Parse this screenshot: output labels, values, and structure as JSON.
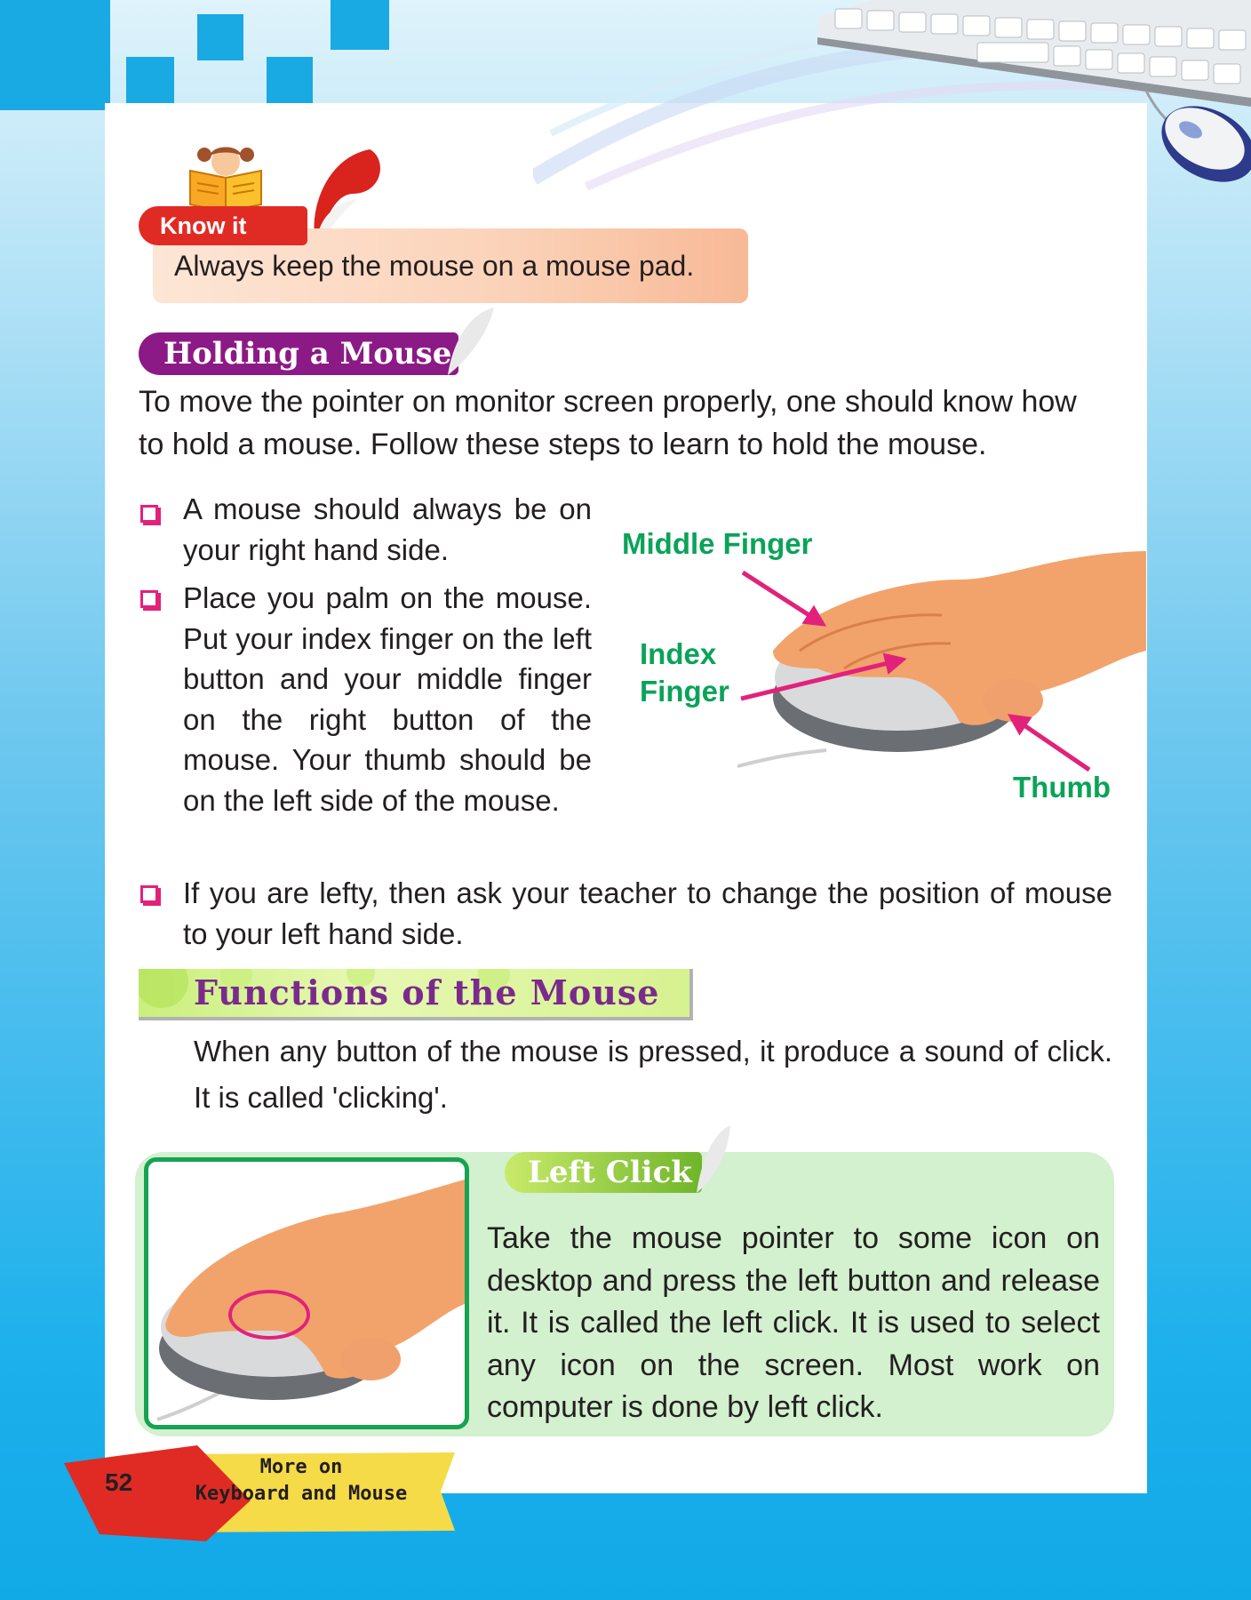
{
  "know_it": {
    "tag": "Know it",
    "tip": "Always keep the mouse on a mouse pad."
  },
  "holding": {
    "heading": "Holding a Mouse",
    "intro_line1": "To move the pointer on monitor screen properly, one should know how",
    "intro_line2": "to hold a mouse. Follow these steps to learn to hold the mouse.",
    "bullets": [
      "A mouse should always be on your right hand side.",
      "Place you palm on the mouse. Put your index finger on the left button and your middle finger on the right button of the mouse. Your thumb should be on the left side of the mouse.",
      "If you are lefty, then ask your teacher to change the position of mouse to your left hand side."
    ],
    "figure_labels": {
      "middle": "Middle Finger",
      "index_1": "Index",
      "index_2": "Finger",
      "thumb": "Thumb"
    }
  },
  "functions": {
    "heading": "Functions of the Mouse",
    "intro": "When any button of the mouse is pressed, it produce a sound of click. It is called 'clicking'."
  },
  "left_click": {
    "heading": "Left Click",
    "text": "Take the mouse pointer to some icon on desktop and press the left button and release it. It is called the left click. It is used to select any icon on the screen. Most work on computer is done by left click."
  },
  "footer": {
    "page_number": "52",
    "chapter_line1": "More on",
    "chapter_line2": "Keyboard and Mouse"
  },
  "colors": {
    "accent_pink": "#e2227a",
    "label_green": "#0aa359",
    "heading_purple": "#8c1a86",
    "knowit_red": "#e02b25"
  }
}
